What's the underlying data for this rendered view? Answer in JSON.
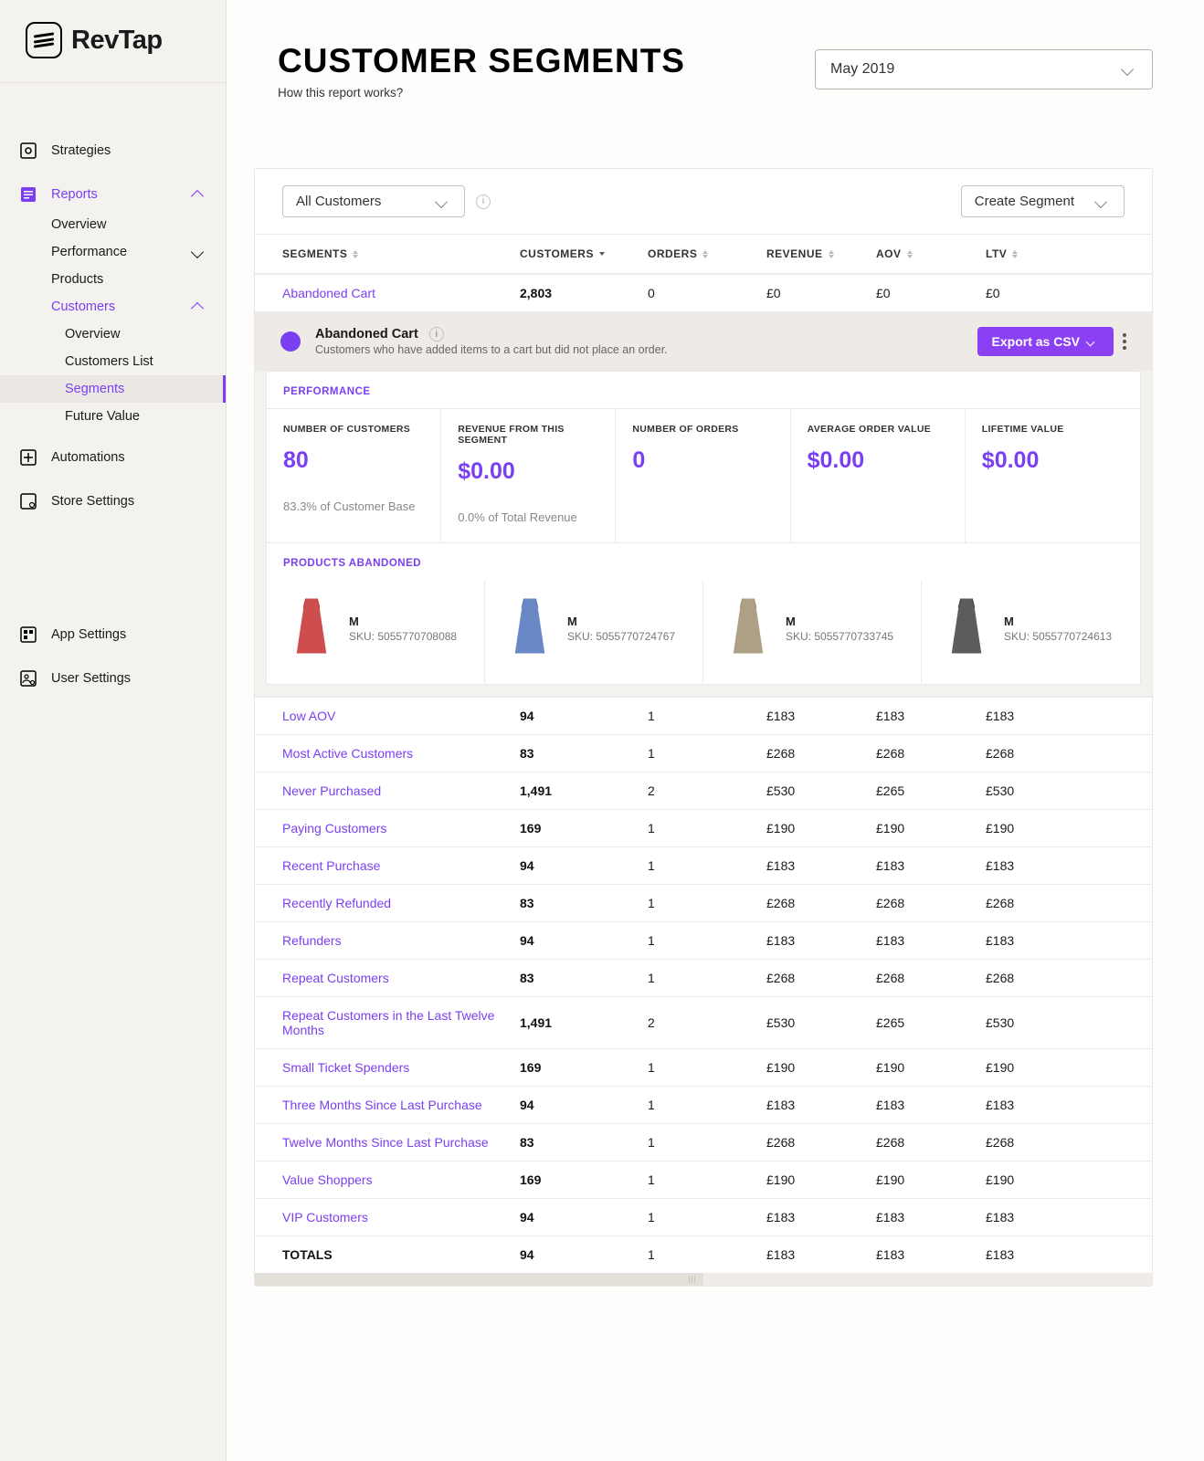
{
  "brand": "RevTap",
  "header": {
    "title": "CUSTOMER SEGMENTS",
    "subtitle": "How this report works?",
    "date": "May 2019"
  },
  "sidebar": {
    "items": [
      {
        "label": "Strategies"
      },
      {
        "label": "Reports",
        "expanded": true,
        "active": true,
        "children": [
          {
            "label": "Overview"
          },
          {
            "label": "Performance",
            "chev": "down"
          },
          {
            "label": "Products"
          },
          {
            "label": "Customers",
            "active": true,
            "chev": "up",
            "children": [
              {
                "label": "Overview"
              },
              {
                "label": "Customers List"
              },
              {
                "label": "Segments",
                "selected": true
              },
              {
                "label": "Future Value"
              }
            ]
          }
        ]
      },
      {
        "label": "Automations"
      },
      {
        "label": "Store Settings"
      }
    ],
    "bottom": [
      {
        "label": "App Settings"
      },
      {
        "label": "User Settings"
      }
    ]
  },
  "filters": {
    "customers": "All Customers",
    "create_segment": "Create Segment"
  },
  "table": {
    "columns": [
      "SEGMENTS",
      "CUSTOMERS",
      "ORDERS",
      "REVENUE",
      "AOV",
      "LTV"
    ],
    "row0": {
      "name": "Abandoned Cart",
      "customers": "2,803",
      "orders": "0",
      "revenue": "£0",
      "aov": "£0",
      "ltv": "£0"
    },
    "rows": [
      {
        "name": "Low AOV",
        "customers": "94",
        "orders": "1",
        "revenue": "£183",
        "aov": "£183",
        "ltv": "£183"
      },
      {
        "name": "Most Active Customers",
        "customers": "83",
        "orders": "1",
        "revenue": "£268",
        "aov": "£268",
        "ltv": "£268"
      },
      {
        "name": "Never Purchased",
        "customers": "1,491",
        "orders": "2",
        "revenue": "£530",
        "aov": "£265",
        "ltv": "£530"
      },
      {
        "name": "Paying Customers",
        "customers": "169",
        "orders": "1",
        "revenue": "£190",
        "aov": "£190",
        "ltv": "£190"
      },
      {
        "name": "Recent Purchase",
        "customers": "94",
        "orders": "1",
        "revenue": "£183",
        "aov": "£183",
        "ltv": "£183"
      },
      {
        "name": "Recently Refunded",
        "customers": "83",
        "orders": "1",
        "revenue": "£268",
        "aov": "£268",
        "ltv": "£268"
      },
      {
        "name": "Refunders",
        "customers": "94",
        "orders": "1",
        "revenue": "£183",
        "aov": "£183",
        "ltv": "£183"
      },
      {
        "name": "Repeat Customers",
        "customers": "83",
        "orders": "1",
        "revenue": "£268",
        "aov": "£268",
        "ltv": "£268"
      },
      {
        "name": "Repeat Customers in the Last Twelve Months",
        "customers": "1,491",
        "orders": "2",
        "revenue": "£530",
        "aov": "£265",
        "ltv": "£530"
      },
      {
        "name": "Small Ticket Spenders",
        "customers": "169",
        "orders": "1",
        "revenue": "£190",
        "aov": "£190",
        "ltv": "£190"
      },
      {
        "name": "Three Months Since Last Purchase",
        "customers": "94",
        "orders": "1",
        "revenue": "£183",
        "aov": "£183",
        "ltv": "£183"
      },
      {
        "name": "Twelve Months Since Last Purchase",
        "customers": "83",
        "orders": "1",
        "revenue": "£268",
        "aov": "£268",
        "ltv": "£268"
      },
      {
        "name": "Value Shoppers",
        "customers": "169",
        "orders": "1",
        "revenue": "£190",
        "aov": "£190",
        "ltv": "£190"
      },
      {
        "name": "VIP Customers",
        "customers": "94",
        "orders": "1",
        "revenue": "£183",
        "aov": "£183",
        "ltv": "£183"
      }
    ],
    "totals": {
      "name": "TOTALS",
      "customers": "94",
      "orders": "1",
      "revenue": "£183",
      "aov": "£183",
      "ltv": "£183"
    }
  },
  "detail": {
    "title": "Abandoned Cart",
    "desc": "Customers who have added items to a cart but did not place an order.",
    "export": "Export as CSV",
    "perf_label": "PERFORMANCE",
    "metrics": [
      {
        "label": "NUMBER OF CUSTOMERS",
        "value": "80",
        "sub": "83.3% of Customer Base"
      },
      {
        "label": "REVENUE FROM THIS SEGMENT",
        "value": "$0.00",
        "sub": "0.0% of Total Revenue"
      },
      {
        "label": "NUMBER OF ORDERS",
        "value": "0",
        "sub": ""
      },
      {
        "label": "AVERAGE ORDER VALUE",
        "value": "$0.00",
        "sub": ""
      },
      {
        "label": "LIFETIME VALUE",
        "value": "$0.00",
        "sub": ""
      }
    ],
    "products_label": "PRODUCTS ABANDONED",
    "products": [
      {
        "name": "M",
        "sku": "SKU: 5055770708088",
        "color": "#c93a3a"
      },
      {
        "name": "M",
        "sku": "SKU: 5055770724767",
        "color": "#5a7bc0"
      },
      {
        "name": "M",
        "sku": "SKU: 5055770733745",
        "color": "#a49678"
      },
      {
        "name": "M",
        "sku": "SKU: 5055770724613",
        "color": "#4a4a4a"
      }
    ]
  }
}
